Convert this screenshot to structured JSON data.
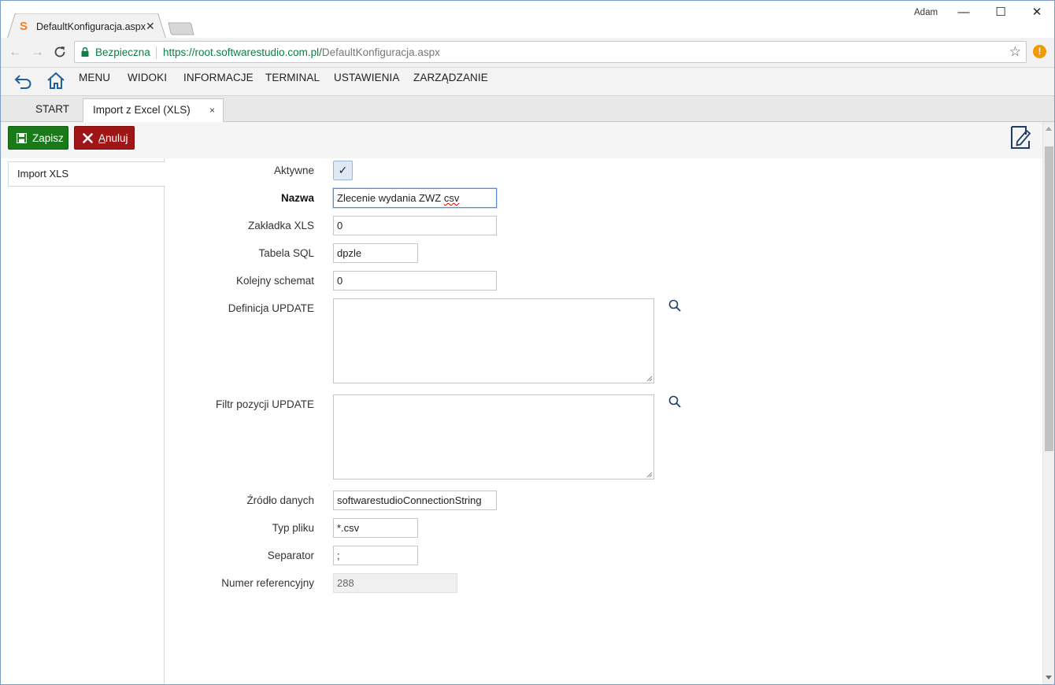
{
  "browser": {
    "tab_title": "DefaultKonfiguracja.aspx",
    "user": "Adam",
    "secure_label": "Bezpieczna",
    "url_host": "https://root.softwarestudio.com.pl/",
    "url_path": "DefaultKonfiguracja.aspx"
  },
  "menu": {
    "items": [
      "MENU",
      "WIDOKI",
      "INFORMACJE",
      "TERMINAL",
      "USTAWIENIA",
      "ZARZĄDZANIE"
    ]
  },
  "tabs": {
    "start": "START",
    "active": "Import z Excel (XLS)",
    "close_glyph": "×"
  },
  "toolbar": {
    "save": "Zapisz",
    "cancel_rest": "nuluj",
    "cancel_accel": "A"
  },
  "leftpanel": {
    "item": "Import XLS"
  },
  "form": {
    "aktywne": {
      "label": "Aktywne",
      "checked": true
    },
    "nazwa": {
      "label": "Nazwa",
      "value_plain": "Zlecenie wydania ZWZ ",
      "value_misspelled": "csv"
    },
    "zakladka": {
      "label": "Zakładka XLS",
      "value": "0"
    },
    "tabela": {
      "label": "Tabela SQL",
      "value": "dpzle"
    },
    "kolejny": {
      "label": "Kolejny schemat",
      "value": "0"
    },
    "definicja": {
      "label": "Definicja UPDATE",
      "value": ""
    },
    "filtr": {
      "label": "Filtr pozycji UPDATE",
      "value": ""
    },
    "zrodlo": {
      "label": "Źródło danych",
      "value": "softwarestudioConnectionString"
    },
    "typ": {
      "label": "Typ pliku",
      "value": "*.csv"
    },
    "separator": {
      "label": "Separator",
      "value": ";"
    },
    "numer": {
      "label": "Numer referencyjny",
      "value": "288"
    }
  },
  "colors": {
    "save_button": "#1a7a1a",
    "cancel_button": "#a01616",
    "secure_green": "#0b8043",
    "window_border": "#7a9cc6"
  }
}
